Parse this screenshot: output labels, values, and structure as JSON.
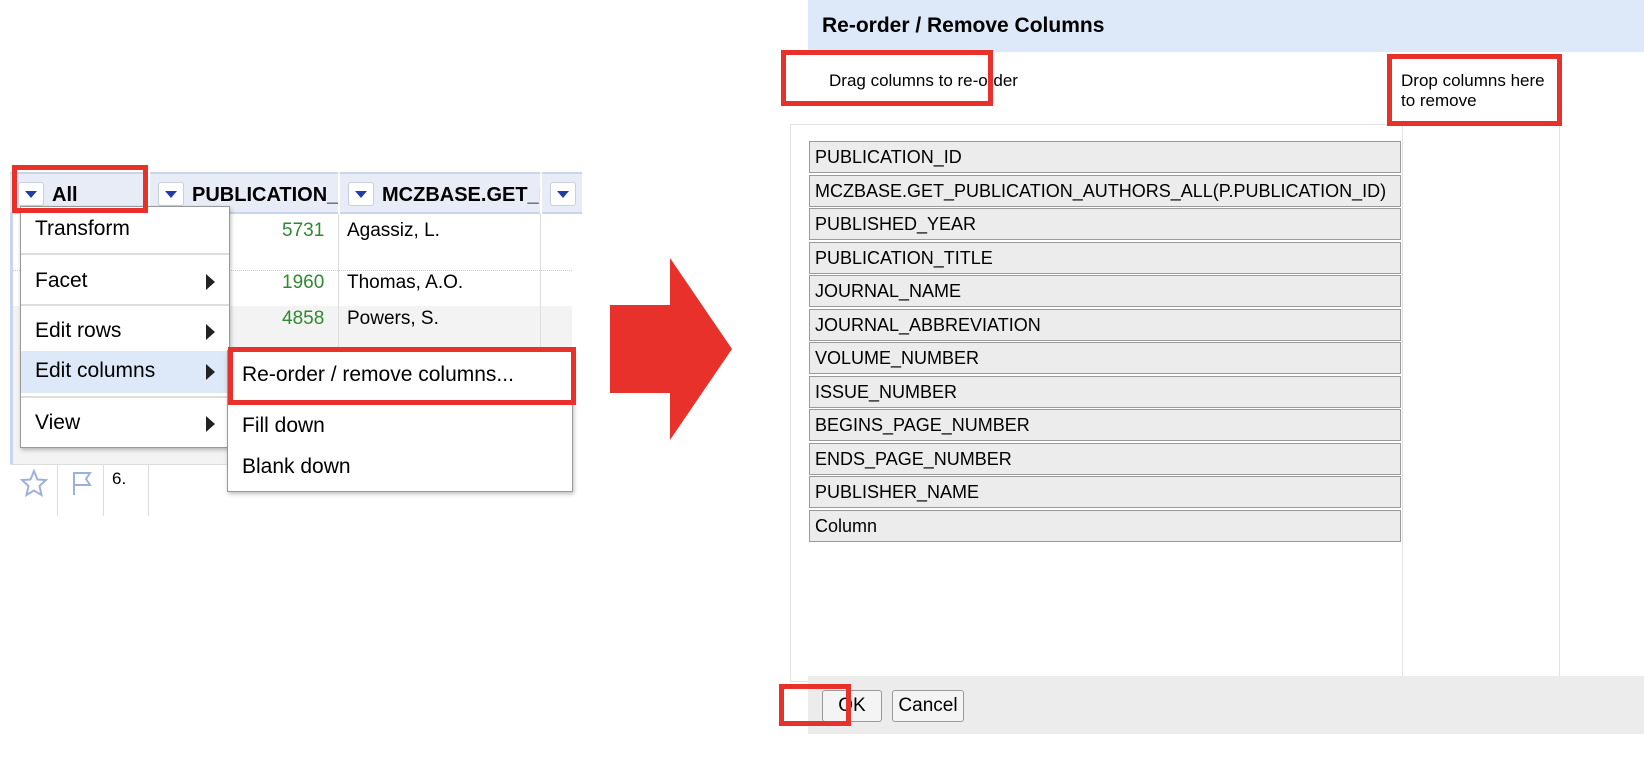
{
  "grid": {
    "columns": [
      {
        "label": "All"
      },
      {
        "label": "PUBLICATION_II"
      },
      {
        "label": "MCZBASE.GET_P"
      },
      {
        "label": ""
      }
    ],
    "rows": [
      {
        "id": "5731",
        "author": "Agassiz, L."
      },
      {
        "id": "1960",
        "author": "Thomas, A.O."
      },
      {
        "id": "4858",
        "author": "Powers, S."
      },
      {
        "id": "",
        "author": ""
      }
    ],
    "row6_label": "6."
  },
  "column_menu": {
    "items": [
      {
        "label": "Transform",
        "submenu": false
      },
      {
        "label": "Facet",
        "submenu": true
      },
      {
        "label": "Edit rows",
        "submenu": true
      },
      {
        "label": "Edit columns",
        "submenu": true,
        "highlighted": true
      },
      {
        "label": "View",
        "submenu": true
      }
    ]
  },
  "edit_columns_submenu": {
    "items": [
      {
        "label": "Re-order / remove columns..."
      },
      {
        "label": "Fill down"
      },
      {
        "label": "Blank down"
      }
    ]
  },
  "arrow": {
    "color": "#e8312a"
  },
  "dialog": {
    "title": "Re-order / Remove Columns",
    "drag_label": "Drag columns to re-order",
    "drop_label": "Drop columns here to remove",
    "columns": [
      "PUBLICATION_ID",
      "MCZBASE.GET_PUBLICATION_AUTHORS_ALL(P.PUBLICATION_ID)",
      "PUBLISHED_YEAR",
      "PUBLICATION_TITLE",
      "JOURNAL_NAME",
      "JOURNAL_ABBREVIATION",
      "VOLUME_NUMBER",
      "ISSUE_NUMBER",
      "BEGINS_PAGE_NUMBER",
      "ENDS_PAGE_NUMBER",
      "PUBLISHER_NAME",
      "Column"
    ],
    "ok_label": "OK",
    "cancel_label": "Cancel"
  },
  "colors": {
    "highlight": "#e8312a",
    "accent": "#1f3ca8",
    "number": "#2f8a2f"
  }
}
